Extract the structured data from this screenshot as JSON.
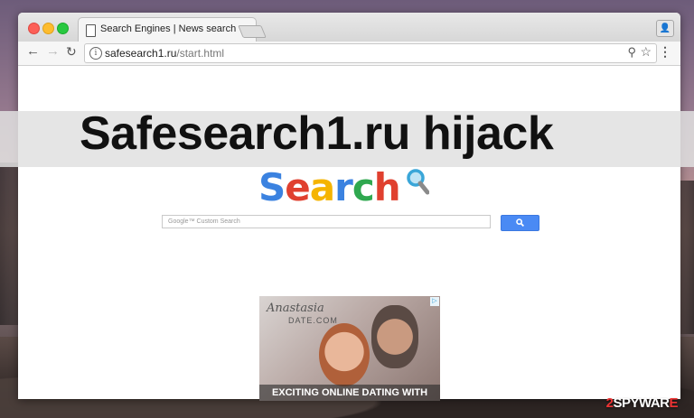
{
  "browser": {
    "tab_title": "Search Engines | News search",
    "tab_close": "×",
    "url_domain": "safesearch1.ru",
    "url_path": "/start.html"
  },
  "overlay": {
    "headline": "Safesearch1.ru hijack"
  },
  "page": {
    "logo_letters": [
      "S",
      "e",
      "a",
      "r",
      "c",
      "h"
    ],
    "logo_colors": [
      "#3b82e0",
      "#e0402f",
      "#f5b400",
      "#3b82e0",
      "#2fa84f",
      "#e0402f"
    ],
    "search_placeholder": "Google™ Custom Search",
    "search_button_icon": "search-icon"
  },
  "ad": {
    "brand": "Anastasia",
    "brand_sub": "DATE.COM",
    "cta": "EXCITING ONLINE DATING WITH",
    "choices_icon": "adchoices-icon"
  },
  "watermark": {
    "digit": "2",
    "text": "SPYWAR",
    "suffix": "E"
  },
  "colors": {
    "search_button": "#4a8af4"
  }
}
